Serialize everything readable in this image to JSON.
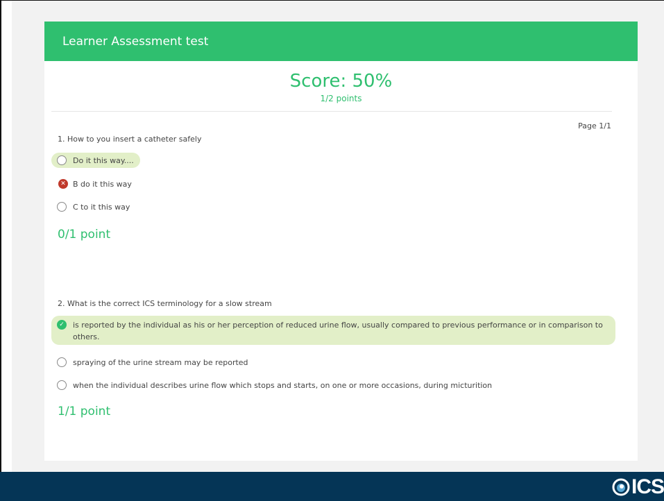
{
  "card": {
    "title": "Learner Assessment test",
    "score_title": "Score: 50%",
    "score_sub": "1/2 points",
    "page_indicator": "Page 1/1"
  },
  "questions": [
    {
      "text": "1. How to you insert a catheter safely",
      "options": [
        {
          "label": "Do it this way....",
          "state": "correct-unselected"
        },
        {
          "label": "B do it this way",
          "state": "wrong-selected"
        },
        {
          "label": "C to it this way",
          "state": "unselected"
        }
      ],
      "points": "0/1 point"
    },
    {
      "text": "2. What is the correct ICS terminology for a slow stream",
      "options": [
        {
          "label": "is reported by the individual as his or her perception of reduced urine flow, usually compared to previous performance or in comparison to others.",
          "state": "correct-selected"
        },
        {
          "label": "spraying of the urine stream may be reported",
          "state": "unselected"
        },
        {
          "label": "when the individual describes urine flow which stops and starts, on one or more occasions, during micturition",
          "state": "unselected"
        }
      ],
      "points": "1/1 point"
    }
  ],
  "footer": {
    "logo_text": "ICS"
  },
  "icons": {
    "wrong": "x-circle-icon",
    "right": "check-circle-icon",
    "logo": "ics-logo"
  },
  "colors": {
    "accent": "#2fbf6f",
    "highlight": "#e2efc8",
    "wrong": "#c0392b",
    "footer": "#053556"
  }
}
